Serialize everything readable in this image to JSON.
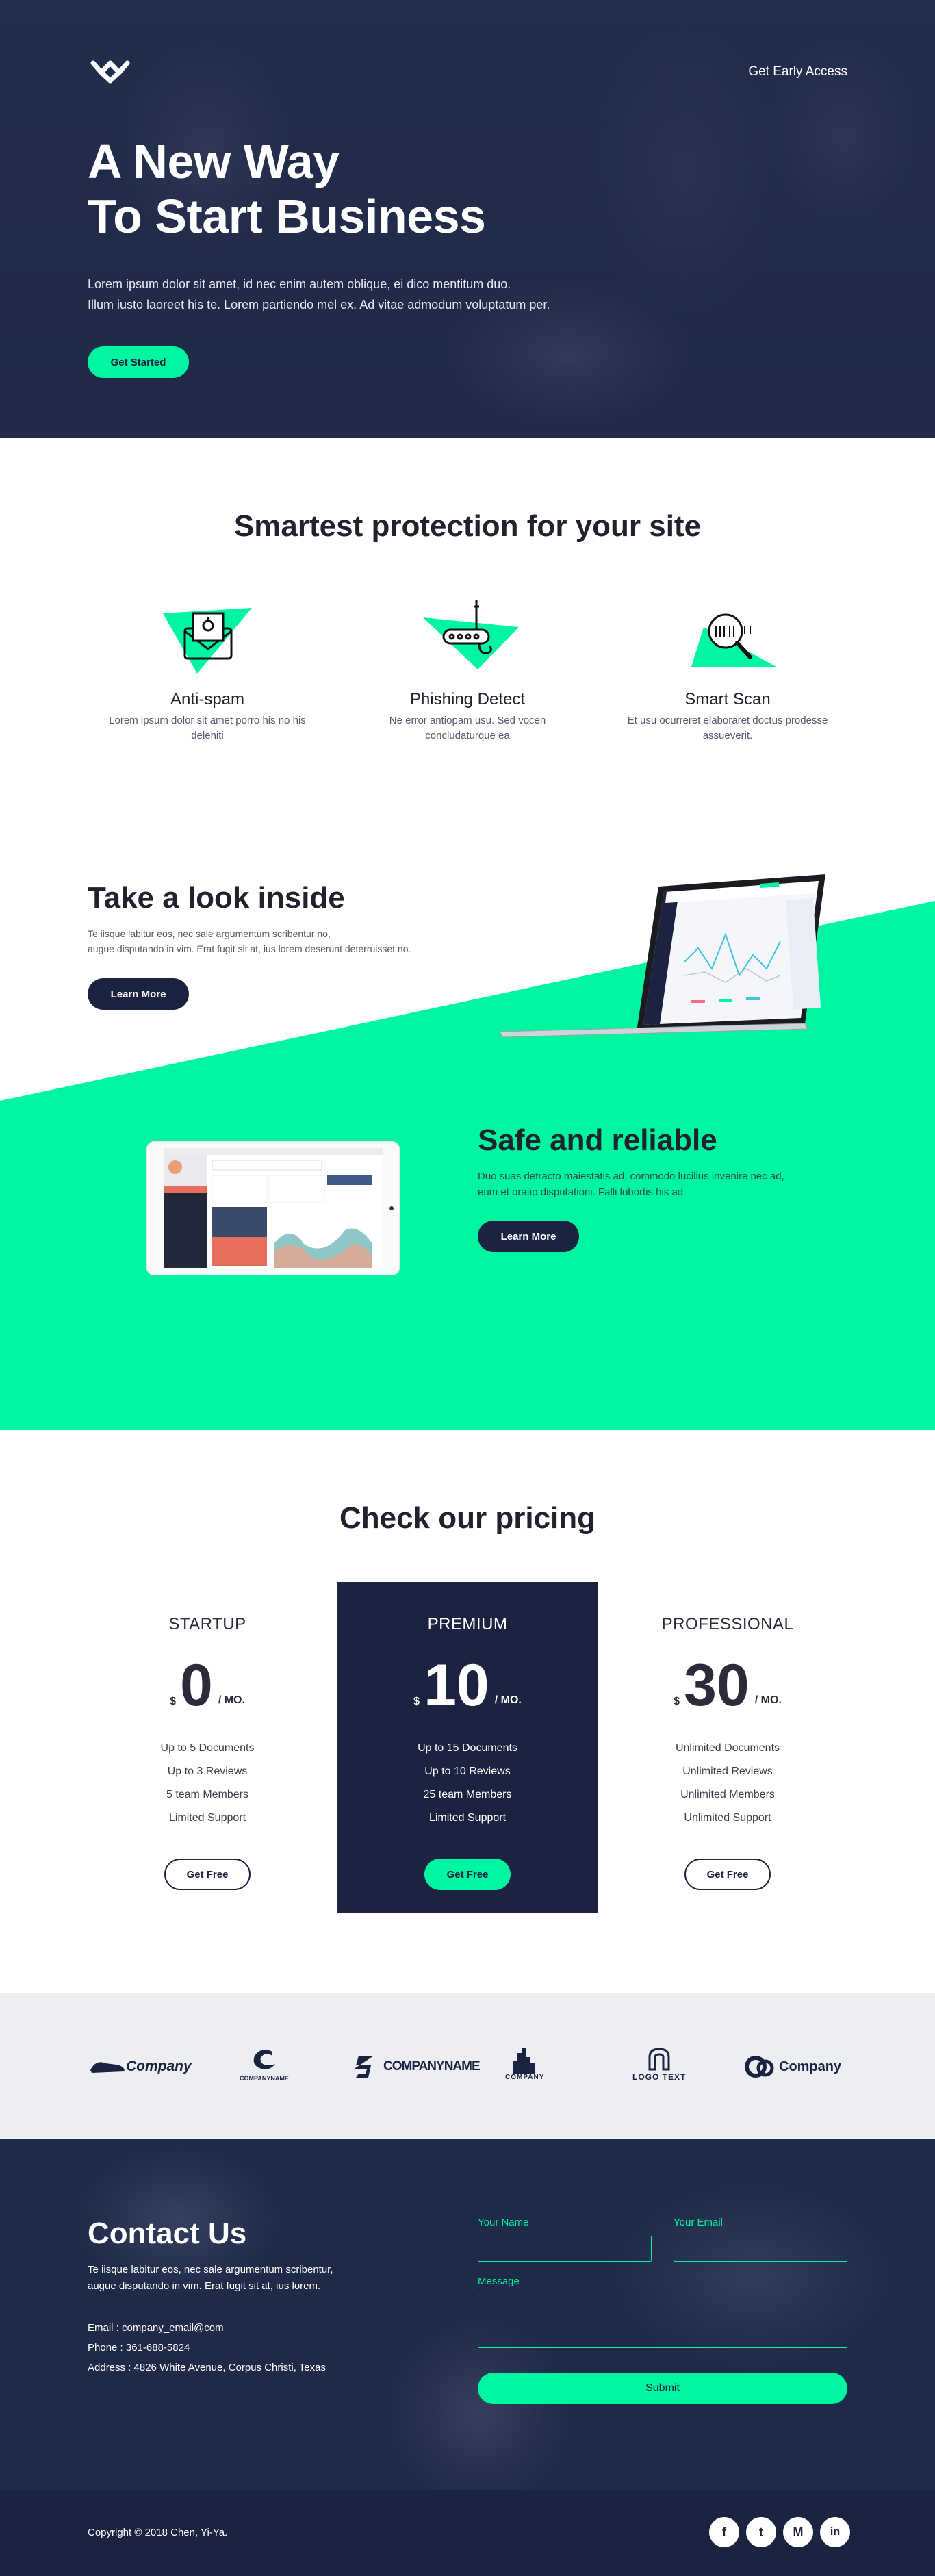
{
  "header": {
    "nav_link": "Get Early Access",
    "title_line1": "A New Way",
    "title_line2": "To Start Business",
    "subtitle_line1": "Lorem ipsum dolor sit amet, id nec enim autem oblique, ei dico mentitum duo.",
    "subtitle_line2": "Illum iusto laoreet his te. Lorem partiendo mel ex. Ad vitae admodum voluptatum per.",
    "cta": "Get Started"
  },
  "features": {
    "title": "Smartest protection for your site",
    "items": [
      {
        "title": "Anti-spam",
        "text": "Lorem ipsum dolor sit amet porro his no his deleniti",
        "icon": "envelope-icon"
      },
      {
        "title": "Phishing Detect",
        "text": "Ne error antiopam usu. Sed vocen concludaturque ea",
        "icon": "fishing-hook-icon"
      },
      {
        "title": "Smart Scan",
        "text": "Et usu ocurreret elaboraret doctus prodesse assueverit.",
        "icon": "magnifier-icon"
      }
    ]
  },
  "look_inside": {
    "title": "Take a look inside",
    "text_line1": "Te iisque labitur eos, nec sale argumentum scribentur no,",
    "text_line2": "augue disputando in vim. Erat fugit sit at, ius lorem deserunt deterruisset no.",
    "button": "Learn More"
  },
  "safe": {
    "title": "Safe and reliable",
    "text_line1": "Duo suas detracto maiestatis ad, commodo lucilius invenire nec ad,",
    "text_line2": "eum et oratio disputationi. Falli lobortis his ad",
    "button": "Learn More"
  },
  "pricing": {
    "title": "Check our pricing",
    "currency": "$",
    "period": "/ MO.",
    "button": "Get Free",
    "plans": [
      {
        "name": "STARTUP",
        "price": "0",
        "features": [
          "Up to 5 Documents",
          "Up to 3 Reviews",
          "5 team Members",
          "Limited Support"
        ]
      },
      {
        "name": "PREMIUM",
        "price": "10",
        "features": [
          "Up to 15 Documents",
          "Up to 10 Reviews",
          "25 team Members",
          "Limited Support"
        ]
      },
      {
        "name": "PROFESSIONAL",
        "price": "30",
        "features": [
          "Unlimited Documents",
          "Unlimited Reviews",
          "Unlimited Members",
          "Unlimited Support"
        ]
      }
    ]
  },
  "logos": [
    {
      "text": "Company",
      "icon": "shoe-logo-icon"
    },
    {
      "text": "COMPANYNAME",
      "icon": "swirl-logo-icon"
    },
    {
      "text": "COMPANYNAME",
      "icon": "s-logo-icon"
    },
    {
      "text": "COMPANY",
      "icon": "city-logo-icon"
    },
    {
      "text": "LOGO TEXT",
      "icon": "horseshoe-logo-icon"
    },
    {
      "text": "Company",
      "icon": "circles-logo-icon"
    }
  ],
  "contact": {
    "title": "Contact Us",
    "lead_line1": "Te iisque labitur eos, nec sale argumentum scribentur,",
    "lead_line2": "augue disputando in vim. Erat fugit sit at, ius lorem.",
    "email": "Email : company_email@com",
    "phone": "Phone : 361-688-5824",
    "address": "Address : 4826 White Avenue, Corpus Christi, Texas",
    "name_label": "Your Name",
    "email_label": "Your Email",
    "message_label": "Message",
    "submit": "Submit"
  },
  "footer": {
    "copyright": "Copyright © 2018 Chen, Yi-Ya.",
    "social": [
      {
        "label": "f",
        "icon": "facebook-icon"
      },
      {
        "label": "t",
        "icon": "twitter-icon"
      },
      {
        "label": "M",
        "icon": "medium-icon"
      },
      {
        "label": "in",
        "icon": "linkedin-icon"
      }
    ]
  },
  "colors": {
    "accent": "#00f5a0",
    "navy": "#1b2341",
    "dark_text": "#22222f",
    "light_bg": "#eceef1"
  }
}
